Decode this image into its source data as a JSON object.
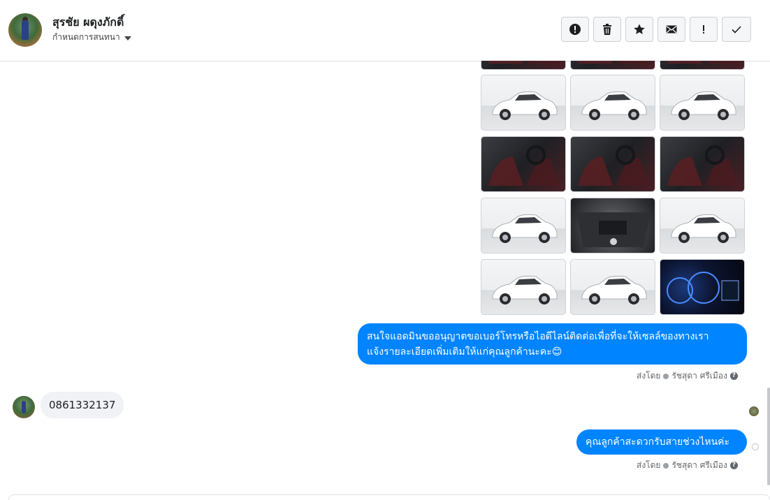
{
  "header": {
    "contact_name": "สุรชัย ผดุงภักดิ์",
    "stage_label": "กำหนดการสนทนา"
  },
  "actions": [
    {
      "name": "spam-icon"
    },
    {
      "name": "trash-icon"
    },
    {
      "name": "star-icon"
    },
    {
      "name": "mail-icon"
    },
    {
      "name": "important-icon"
    },
    {
      "name": "check-icon"
    }
  ],
  "conversation": {
    "photos": [
      {
        "kind": "interior"
      },
      {
        "kind": "interior"
      },
      {
        "kind": "interior"
      },
      {
        "kind": "studio-front-left"
      },
      {
        "kind": "studio-front-right"
      },
      {
        "kind": "studio-side"
      },
      {
        "kind": "interior"
      },
      {
        "kind": "interior"
      },
      {
        "kind": "interior"
      },
      {
        "kind": "studio-rear"
      },
      {
        "kind": "engine"
      },
      {
        "kind": "studio-front"
      },
      {
        "kind": "studio-wheel"
      },
      {
        "kind": "studio-side"
      },
      {
        "kind": "dash"
      }
    ],
    "msg1": {
      "line1": "สนใจแอดมินขออนุญาตขอเบอร์โทรหรือไอดีไลน์ติดต่อเพื่อที่จะให้เซลล์ของทางเรา",
      "line2": "แจ้งรายละเอียดเพิ่มเติมให้แก่คุณลูกค้านะคะ😊"
    },
    "sent_by_label": "ส่งโดย",
    "agent_name": "รัชสุดา ศรีเมือง",
    "incoming": "0861332137",
    "msg2": "คุณลูกค้าสะดวกรับสายช่วงไหนค่ะ"
  }
}
